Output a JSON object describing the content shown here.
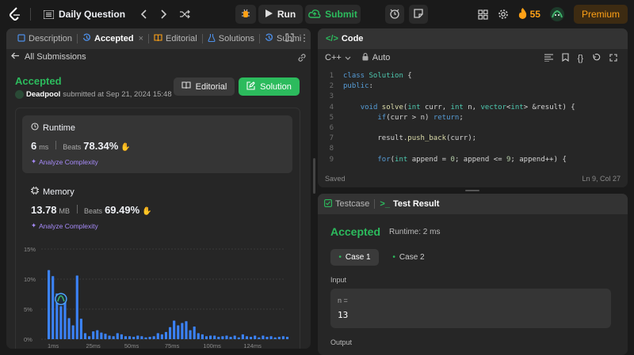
{
  "topbar": {
    "title": "Daily Question",
    "run_label": "Run",
    "submit_label": "Submit",
    "streak": "55",
    "premium_label": "Premium"
  },
  "left": {
    "tabs": [
      {
        "label": "Description"
      },
      {
        "label": "Accepted"
      },
      {
        "label": "Editorial"
      },
      {
        "label": "Solutions"
      },
      {
        "label": "Submi"
      }
    ],
    "back_label": "All Submissions",
    "status": "Accepted",
    "user": "Deadpool",
    "submitted_text": "submitted at Sep 21, 2024 15:48",
    "editorial_button": "Editorial",
    "solution_button": "Solution",
    "runtime": {
      "title": "Runtime",
      "value": "6",
      "unit": "ms",
      "beats_label": "Beats",
      "beats": "78.34%",
      "analyze": "Analyze Complexity"
    },
    "memory": {
      "title": "Memory",
      "value": "13.78",
      "unit": "MB",
      "beats_label": "Beats",
      "beats": "69.49%",
      "analyze": "Analyze Complexity"
    }
  },
  "chart_data": {
    "type": "bar",
    "y_ticks": [
      "15%",
      "10%",
      "5%",
      "0%"
    ],
    "ylim": [
      0,
      15
    ],
    "x_ticks": [
      "1ms",
      "25ms",
      "50ms",
      "75ms",
      "100ms",
      "124ms"
    ],
    "values": [
      11.5,
      10.5,
      7.6,
      5.5,
      6.9,
      3.5,
      2.3,
      10.6,
      3.4,
      1.0,
      0.5,
      1.3,
      1.5,
      1.1,
      0.9,
      0.6,
      0.5,
      1.0,
      0.8,
      0.5,
      0.5,
      0.4,
      0.6,
      0.5,
      0.3,
      0.4,
      0.5,
      1.0,
      0.8,
      1.2,
      2.0,
      3.1,
      2.3,
      2.7,
      3.0,
      1.5,
      2.1,
      1.0,
      0.8,
      0.5,
      0.6,
      0.6,
      0.4,
      0.5,
      0.6,
      0.4,
      0.6,
      0.3,
      0.8,
      0.5,
      0.4,
      0.6,
      0.3,
      0.6,
      0.4,
      0.5,
      0.3,
      0.4,
      0.5,
      0.4
    ],
    "highlight_index": 3,
    "colors": {
      "bar": "#3b82f6",
      "grid": "#3a3a3a"
    }
  },
  "code": {
    "title": "Code",
    "language": "C++",
    "mode": "Auto",
    "lines": [
      {
        "n": "1",
        "html": "class Solution {"
      },
      {
        "n": "2",
        "html": "public:"
      },
      {
        "n": "3",
        "html": ""
      },
      {
        "n": "4",
        "html": "    void solve(int curr, int n, vector<int> &result) {"
      },
      {
        "n": "5",
        "html": "        if(curr > n) return;"
      },
      {
        "n": "6",
        "html": ""
      },
      {
        "n": "7",
        "html": "        result.push_back(curr);"
      },
      {
        "n": "8",
        "html": ""
      },
      {
        "n": "9",
        "html": "        for(int append = 0; append <= 9; append++) {"
      }
    ],
    "status_left": "Saved",
    "status_right": "Ln 9, Col 27"
  },
  "result": {
    "tab_testcase": "Testcase",
    "tab_result": "Test Result",
    "status": "Accepted",
    "runtime": "Runtime: 2 ms",
    "cases": [
      "Case 1",
      "Case 2"
    ],
    "input_label": "Input",
    "var_name": "n =",
    "var_value": "13",
    "output_label": "Output"
  },
  "colors": {
    "accent_green": "#2cbb5d",
    "orange": "#ffa116",
    "purple": "#a78bfa"
  }
}
